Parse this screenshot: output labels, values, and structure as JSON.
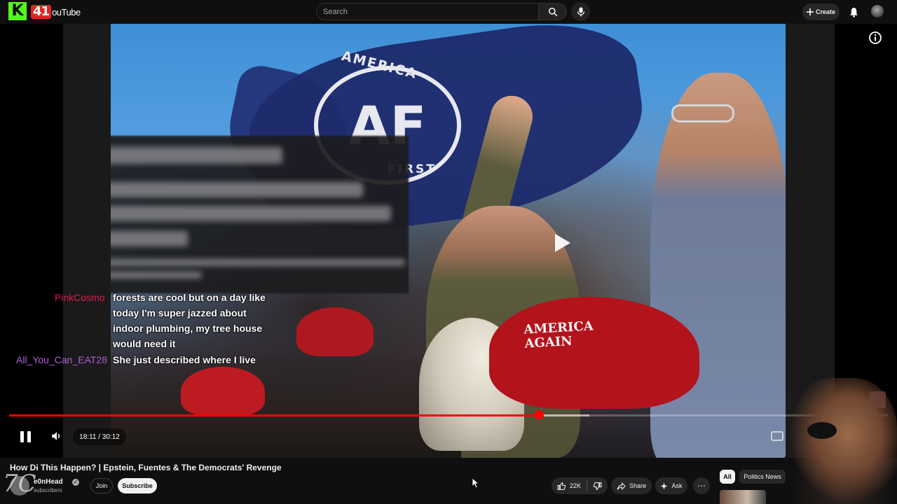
{
  "header": {
    "kick_logo_letter": "K",
    "yt_badge": "41",
    "yt_word": "ouTube",
    "search_placeholder": "Search",
    "create_label": "Create",
    "icons": [
      "search-icon",
      "mic-icon",
      "plus-icon",
      "bell-icon",
      "avatar"
    ]
  },
  "player": {
    "frame_text": {
      "flag_top": "AMERICA",
      "flag_letters": "AF",
      "flag_bottom": "FIRST",
      "hat_text_line1": "AMERICA",
      "hat_text_line2": "AGAIN"
    },
    "chat": [
      {
        "user": "PinkCosmo",
        "user_color": "#e0194b",
        "lines": [
          "forests are cool but on a day like",
          "today I'm super jazzed about",
          "indoor plumbing, my tree house",
          "would need it"
        ]
      },
      {
        "user": "All_You_Can_EAT28",
        "user_color": "#b05ed6",
        "lines": [
          "She just described where I live"
        ]
      }
    ],
    "time_display": "18:11 / 30:12",
    "progress_fraction": 0.603,
    "buffered_fraction": 0.66,
    "colors": {
      "progress": "#ff0000",
      "accent": "#53fc18"
    }
  },
  "video": {
    "title": "How Di   This Happen? | Epstein, Fuentes & The Democrats' Revenge",
    "channel_name": "e0nHead",
    "subscribers": "subscribers",
    "watermark": "7C",
    "join_label": "Join",
    "subscribe_label": "Subscribe",
    "likes": "22K",
    "share_label": "Share",
    "ask_label": "Ask",
    "more_label": "⋯"
  },
  "sidebar_chips": {
    "all": "All",
    "politics": "Politics News"
  }
}
